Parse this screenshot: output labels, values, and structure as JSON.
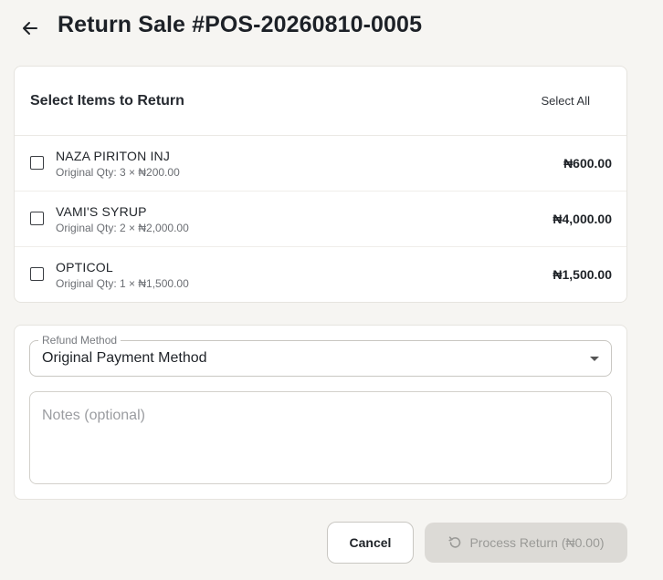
{
  "header": {
    "title": "Return Sale #POS-20260810-0005",
    "back_icon": "arrow-left-icon"
  },
  "items_section": {
    "title": "Select Items to Return",
    "select_all_label": "Select All",
    "items": [
      {
        "name": "NAZA PIRITON INJ",
        "meta": "Original Qty: 3 × ₦200.00",
        "price": "₦600.00",
        "checked": false
      },
      {
        "name": "VAMI'S SYRUP",
        "meta": "Original Qty: 2 × ₦2,000.00",
        "price": "₦4,000.00",
        "checked": false
      },
      {
        "name": "OPTICOL",
        "meta": "Original Qty: 1 × ₦1,500.00",
        "price": "₦1,500.00",
        "checked": false
      }
    ]
  },
  "refund": {
    "method_label": "Refund Method",
    "method_value": "Original Payment Method",
    "notes_placeholder": "Notes (optional)",
    "notes_value": ""
  },
  "actions": {
    "cancel_label": "Cancel",
    "process_label": "Process Return (₦0.00)",
    "process_icon": "undo-icon",
    "process_disabled": true
  }
}
